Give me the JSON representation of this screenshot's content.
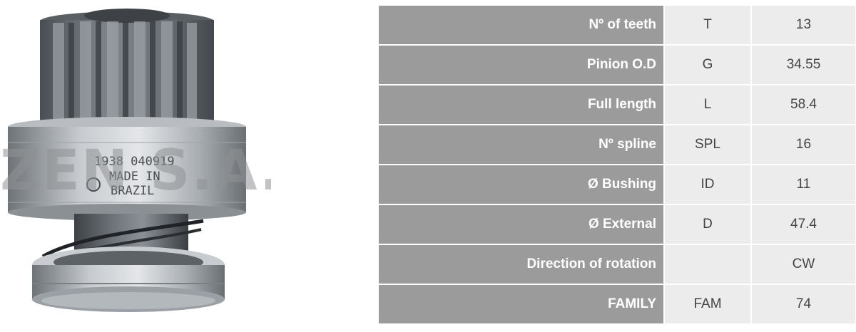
{
  "product_image": {
    "stamp_line1": "1938 040919",
    "stamp_line2": "MADE IN",
    "stamp_line3": "BRAZIL",
    "watermark": "ZEN S.A."
  },
  "specs": [
    {
      "label": "Nº of teeth",
      "code": "T",
      "value": "13"
    },
    {
      "label": "Pinion O.D",
      "code": "G",
      "value": "34.55"
    },
    {
      "label": "Full length",
      "code": "L",
      "value": "58.4"
    },
    {
      "label": "Nº spline",
      "code": "SPL",
      "value": "16"
    },
    {
      "label": "Ø Bushing",
      "code": "ID",
      "value": "11"
    },
    {
      "label": "Ø External",
      "code": "D",
      "value": "47.4"
    },
    {
      "label": "Direction of rotation",
      "code": "",
      "value": "CW"
    },
    {
      "label": "FAMILY",
      "code": "FAM",
      "value": "74"
    }
  ]
}
